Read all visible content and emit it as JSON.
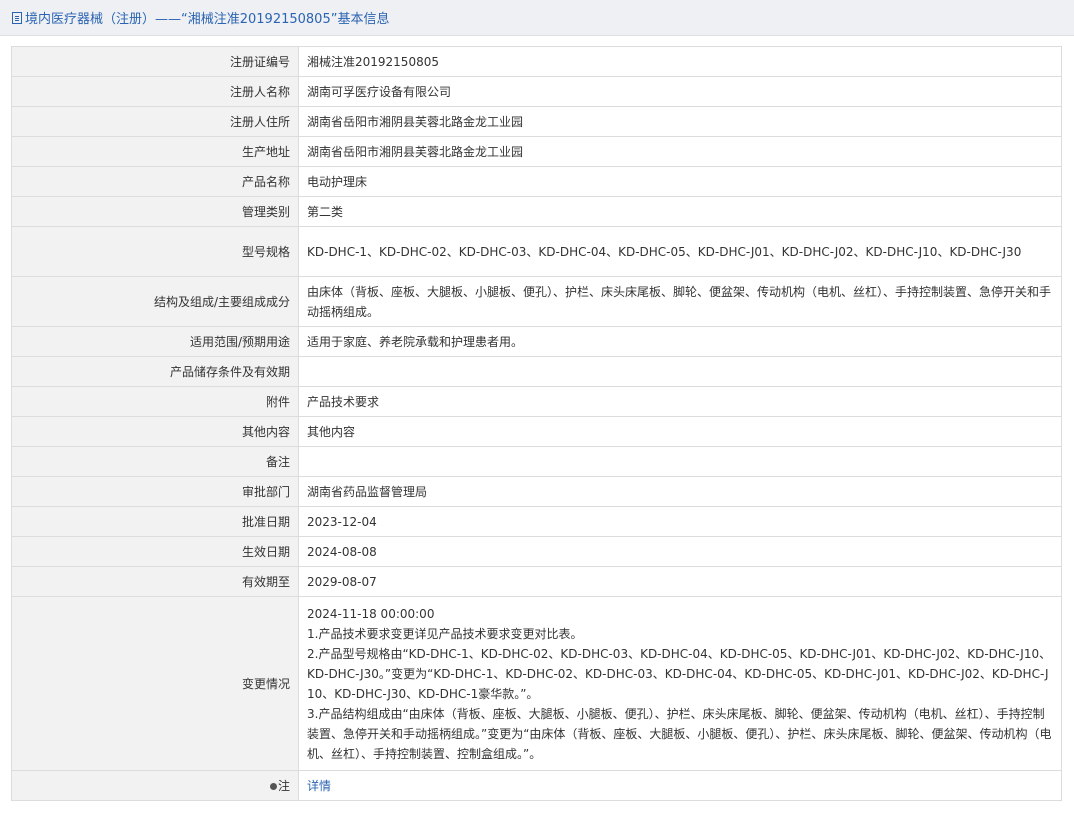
{
  "header": {
    "title": "境内医疗器械（注册）——“湘械注准20192150805”基本信息"
  },
  "rows": [
    {
      "label": "注册证编号",
      "value": "湘械注准20192150805"
    },
    {
      "label": "注册人名称",
      "value": "湖南可孚医疗设备有限公司"
    },
    {
      "label": "注册人住所",
      "value": "湖南省岳阳市湘阴县芙蓉北路金龙工业园"
    },
    {
      "label": "生产地址",
      "value": "湖南省岳阳市湘阴县芙蓉北路金龙工业园"
    },
    {
      "label": "产品名称",
      "value": "电动护理床"
    },
    {
      "label": "管理类别",
      "value": "第二类"
    },
    {
      "label": "型号规格",
      "value": "KD-DHC-1、KD-DHC-02、KD-DHC-03、KD-DHC-04、KD-DHC-05、KD-DHC-J01、KD-DHC-J02、KD-DHC-J10、KD-DHC-J30"
    },
    {
      "label": "结构及组成/主要组成成分",
      "value": "由床体（背板、座板、大腿板、小腿板、便孔）、护栏、床头床尾板、脚轮、便盆架、传动机构（电机、丝杠）、手持控制装置、急停开关和手动摇柄组成。"
    },
    {
      "label": "适用范围/预期用途",
      "value": "适用于家庭、养老院承载和护理患者用。"
    },
    {
      "label": "产品储存条件及有效期",
      "value": ""
    },
    {
      "label": "附件",
      "value": "产品技术要求"
    },
    {
      "label": "其他内容",
      "value": "其他内容"
    },
    {
      "label": "备注",
      "value": ""
    },
    {
      "label": "审批部门",
      "value": "湖南省药品监督管理局"
    },
    {
      "label": "批准日期",
      "value": "2023-12-04"
    },
    {
      "label": "生效日期",
      "value": "2024-08-08"
    },
    {
      "label": "有效期至",
      "value": "2029-08-07"
    }
  ],
  "change": {
    "label": "变更情况",
    "lines": [
      "2024-11-18 00:00:00",
      "1.产品技术要求变更详见产品技术要求变更对比表。",
      "2.产品型号规格由“KD-DHC-1、KD-DHC-02、KD-DHC-03、KD-DHC-04、KD-DHC-05、KD-DHC-J01、KD-DHC-J02、KD-DHC-J10、KD-DHC-J30。”变更为“KD-DHC-1、KD-DHC-02、KD-DHC-03、KD-DHC-04、KD-DHC-05、KD-DHC-J01、KD-DHC-J02、KD-DHC-J10、KD-DHC-J30、KD-DHC-1豪华款。”。",
      "3.产品结构组成由“由床体（背板、座板、大腿板、小腿板、便孔）、护栏、床头床尾板、脚轮、便盆架、传动机构（电机、丝杠）、手持控制装置、急停开关和手动摇柄组成。”变更为“由床体（背板、座板、大腿板、小腿板、便孔）、护栏、床头床尾板、脚轮、便盆架、传动机构（电机、丝杠）、手持控制装置、控制盒组成。”。"
    ]
  },
  "note": {
    "label": "注",
    "icon": "lightbulb-icon",
    "link_text": "详情"
  },
  "colors": {
    "link": "#2b64b3",
    "label_bg": "#f2f2f2",
    "border": "#dcdcdc"
  }
}
